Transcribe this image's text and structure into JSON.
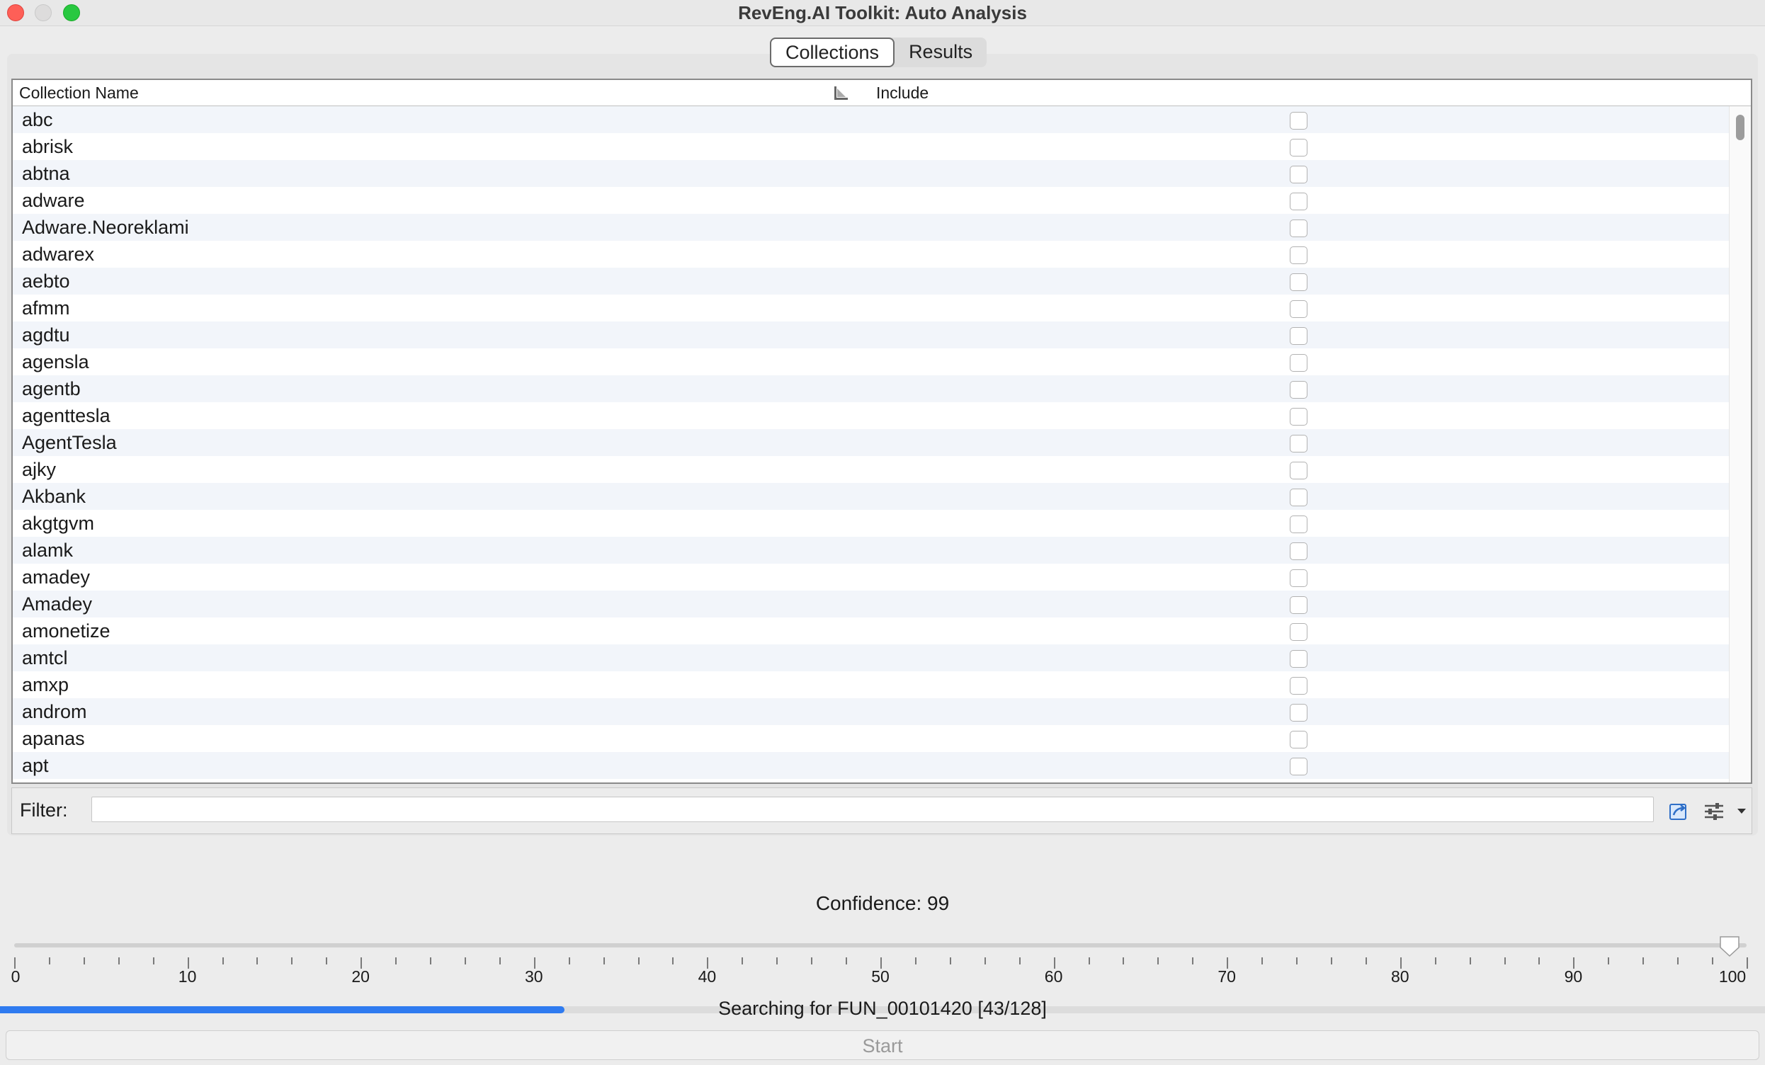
{
  "window": {
    "title": "RevEng.AI Toolkit: Auto Analysis"
  },
  "tabs": [
    {
      "label": "Collections",
      "active": true
    },
    {
      "label": "Results",
      "active": false
    }
  ],
  "table": {
    "columns": {
      "name": "Collection Name",
      "include": "Include"
    },
    "rows": [
      {
        "name": "abc",
        "included": false
      },
      {
        "name": "abrisk",
        "included": false
      },
      {
        "name": "abtna",
        "included": false
      },
      {
        "name": "adware",
        "included": false
      },
      {
        "name": "Adware.Neoreklami",
        "included": false
      },
      {
        "name": "adwarex",
        "included": false
      },
      {
        "name": "aebto",
        "included": false
      },
      {
        "name": "afmm",
        "included": false
      },
      {
        "name": "agdtu",
        "included": false
      },
      {
        "name": "agensla",
        "included": false
      },
      {
        "name": "agentb",
        "included": false
      },
      {
        "name": "agenttesla",
        "included": false
      },
      {
        "name": "AgentTesla",
        "included": false
      },
      {
        "name": "ajky",
        "included": false
      },
      {
        "name": "Akbank",
        "included": false
      },
      {
        "name": "akgtgvm",
        "included": false
      },
      {
        "name": "alamk",
        "included": false
      },
      {
        "name": "amadey",
        "included": false
      },
      {
        "name": "Amadey",
        "included": false
      },
      {
        "name": "amonetize",
        "included": false
      },
      {
        "name": "amtcl",
        "included": false
      },
      {
        "name": "amxp",
        "included": false
      },
      {
        "name": "androm",
        "included": false
      },
      {
        "name": "apanas",
        "included": false
      },
      {
        "name": "apt",
        "included": false
      }
    ]
  },
  "filter": {
    "label": "Filter:",
    "value": "",
    "placeholder": ""
  },
  "confidence": {
    "label": "Confidence: 99",
    "value": 99
  },
  "slider": {
    "min": 0,
    "max": 100,
    "value": 99,
    "labels": [
      "0",
      "10",
      "20",
      "30",
      "40",
      "50",
      "60",
      "70",
      "80",
      "90",
      "100"
    ]
  },
  "progress": {
    "status": "Searching for FUN_00101420 [43/128]",
    "current": 43,
    "total": 128,
    "fraction": 0.32
  },
  "start_button": {
    "label": "Start",
    "enabled": false
  },
  "colors": {
    "accent": "#2f7bf0",
    "row_stripe": "#f2f5fa",
    "close": "#fe5f57",
    "maximize": "#28c840"
  }
}
